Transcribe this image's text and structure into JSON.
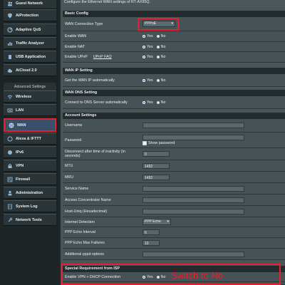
{
  "sidebar": {
    "top_items": [
      {
        "label": "Guest Network",
        "icon": "guest-icon"
      },
      {
        "label": "AiProtection",
        "icon": "shield-icon"
      },
      {
        "label": "Adaptive QoS",
        "icon": "qos-icon"
      },
      {
        "label": "Traffic Analyzer",
        "icon": "chart-icon"
      },
      {
        "label": "USB Application",
        "icon": "usb-icon"
      },
      {
        "label": "AiCloud 2.0",
        "icon": "cloud-icon"
      }
    ],
    "advanced_header": "Advanced Settings",
    "advanced_items": [
      {
        "label": "Wireless",
        "icon": "wifi-icon"
      },
      {
        "label": "LAN",
        "icon": "lan-icon"
      },
      {
        "label": "WAN",
        "icon": "globe-icon",
        "active": true
      },
      {
        "label": "Alexa & IFTTT",
        "icon": "alexa-icon"
      },
      {
        "label": "IPv6",
        "icon": "ipv6-icon"
      },
      {
        "label": "VPN",
        "icon": "vpn-icon"
      },
      {
        "label": "Firewall",
        "icon": "firewall-icon"
      },
      {
        "label": "Administration",
        "icon": "admin-icon"
      },
      {
        "label": "System Log",
        "icon": "log-icon"
      },
      {
        "label": "Network Tools",
        "icon": "tools-icon"
      }
    ]
  },
  "description": "Configure the Ethernet WAN settings of RT-AX95Q.",
  "sections": {
    "basic": "Basic Config",
    "wan_ip": "WAN IP Setting",
    "wan_dns": "WAN DNS Setting",
    "account": "Account Settings",
    "isp": "Special Requirement from ISP"
  },
  "basic": {
    "conn_type_label": "WAN Connection Type",
    "conn_type_value": "PPPoE",
    "enable_wan_label": "Enable WAN",
    "enable_nat_label": "Enable NAT",
    "enable_upnp_label": "Enable UPnP",
    "upnp_faq": "UPnP  FAQ"
  },
  "radio": {
    "yes": "Yes",
    "no": "No"
  },
  "wan_ip": {
    "auto_label": "Get the WAN IP automatically"
  },
  "wan_dns": {
    "connect_label": "Connect to DNS Server automatically"
  },
  "account": {
    "username_label": "Username",
    "password_label": "Password",
    "show_password": "Show password",
    "disconnect_label": "Disconnect after time of inactivity (in seconds)",
    "disconnect_value": "0",
    "mtu_label": "MTU",
    "mtu_value": "1492",
    "mru_label": "MRU",
    "mru_value": "1492",
    "service_name_label": "Service Name",
    "concentrator_label": "Access Concentrator Name",
    "host_uniq_label": "Host-Uniq (Hexadecimal)",
    "internet_detection_label": "Internet Detection",
    "internet_detection_value": "PPP Echo",
    "echo_interval_label": "PPP Echo Interval",
    "echo_interval_value": "6",
    "echo_failures_label": "PPP Echo Max Failures",
    "echo_failures_value": "10",
    "additional_label": "Additional pppd options"
  },
  "isp": {
    "vpn_dhcp_label": "Enable VPN + DHCP Connection"
  },
  "annotation": "Switch to No",
  "colors": {
    "highlight": "#e52030",
    "radio_on": "#2b6fd6"
  }
}
